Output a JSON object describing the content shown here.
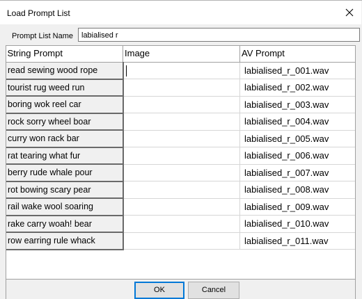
{
  "window": {
    "title": "Load Prompt List"
  },
  "name_field": {
    "label": "Prompt List Name",
    "value": "labialised r"
  },
  "grid": {
    "columns": [
      "String Prompt",
      "Image",
      "AV Prompt"
    ],
    "rows": [
      {
        "prompt": "read sewing wood rope",
        "image": "",
        "av": "labialised_r_001.wav"
      },
      {
        "prompt": "tourist rug weed run",
        "image": "",
        "av": "labialised_r_002.wav"
      },
      {
        "prompt": "boring wok reel car",
        "image": "",
        "av": "labialised_r_003.wav"
      },
      {
        "prompt": "rock sorry wheel boar",
        "image": "",
        "av": "labialised_r_004.wav"
      },
      {
        "prompt": "curry won rack bar",
        "image": "",
        "av": "labialised_r_005.wav"
      },
      {
        "prompt": "rat tearing what fur",
        "image": "",
        "av": "labialised_r_006.wav"
      },
      {
        "prompt": "berry rude whale pour",
        "image": "",
        "av": "labialised_r_007.wav"
      },
      {
        "prompt": "rot bowing scary pear",
        "image": "",
        "av": "labialised_r_008.wav"
      },
      {
        "prompt": "rail wake wool soaring",
        "image": "",
        "av": "labialised_r_009.wav"
      },
      {
        "prompt": "rake carry woah! bear",
        "image": "",
        "av": "labialised_r_010.wav"
      },
      {
        "prompt": "row earring rule whack",
        "image": "",
        "av": "labialised_r_011.wav"
      }
    ]
  },
  "buttons": {
    "ok": "OK",
    "cancel": "Cancel"
  },
  "icons": {
    "close": "close-icon"
  }
}
